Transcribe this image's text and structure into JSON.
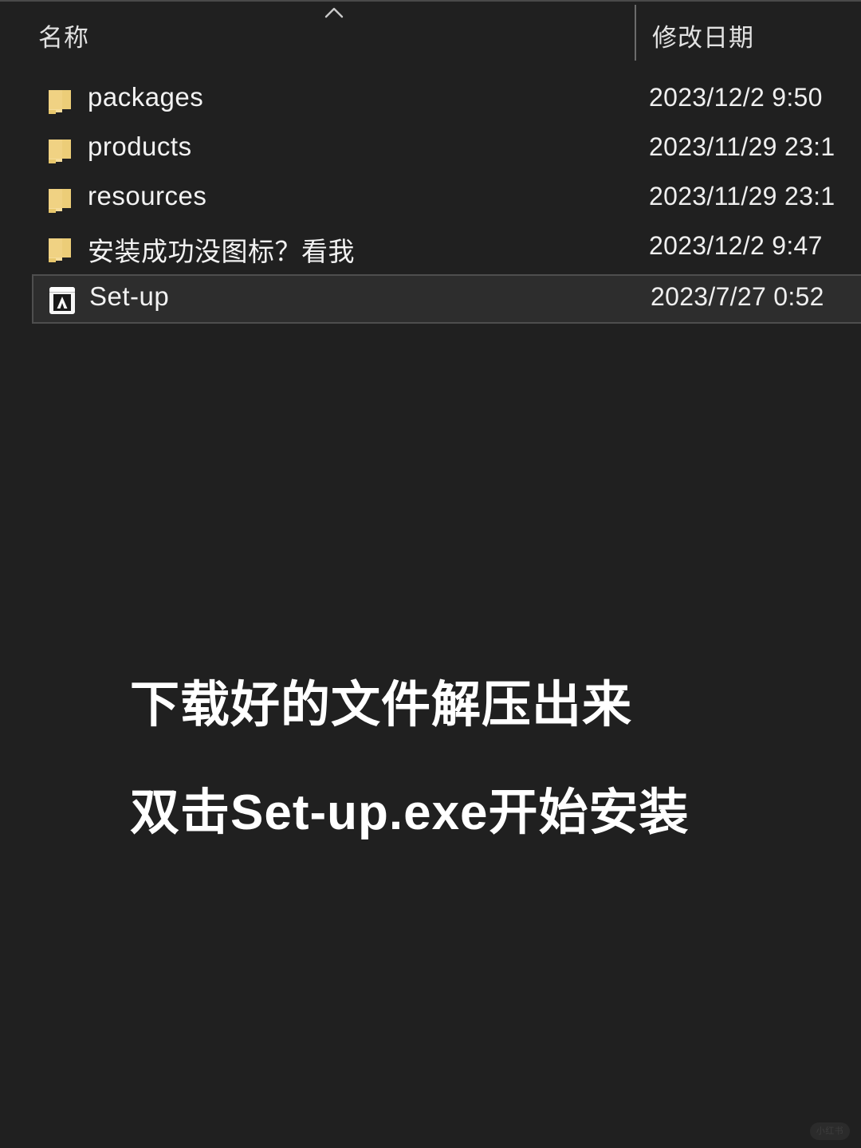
{
  "window": {
    "background_color": "#202020",
    "text_color": "#f2f2f2"
  },
  "columns": {
    "name_label": "名称",
    "date_label": "修改日期",
    "sort_indicator": "chevron-up-icon"
  },
  "files": [
    {
      "name": "packages",
      "date": "2023/12/2 9:50",
      "icon": "folder-icon",
      "selected": false
    },
    {
      "name": "products",
      "date": "2023/11/29 23:1",
      "icon": "folder-icon",
      "selected": false
    },
    {
      "name": "resources",
      "date": "2023/11/29 23:1",
      "icon": "folder-icon",
      "selected": false
    },
    {
      "name": "安装成功没图标？看我",
      "date": "2023/12/2 9:47",
      "icon": "folder-icon",
      "selected": false
    },
    {
      "name": "Set-up",
      "date": "2023/7/27 0:52",
      "icon": "adobe-installer-icon",
      "selected": true
    }
  ],
  "caption": {
    "line1": "下载好的文件解压出来",
    "line2": "双击Set-up.exe开始安装"
  },
  "watermark": {
    "text": "小红书"
  },
  "colors": {
    "folder_yellow": "#f2d686",
    "folder_yellow_dark": "#e6c36a",
    "selection_bg": "#2d2d2d",
    "selection_border": "#4e4e4e",
    "divider": "#6b6b6b"
  }
}
